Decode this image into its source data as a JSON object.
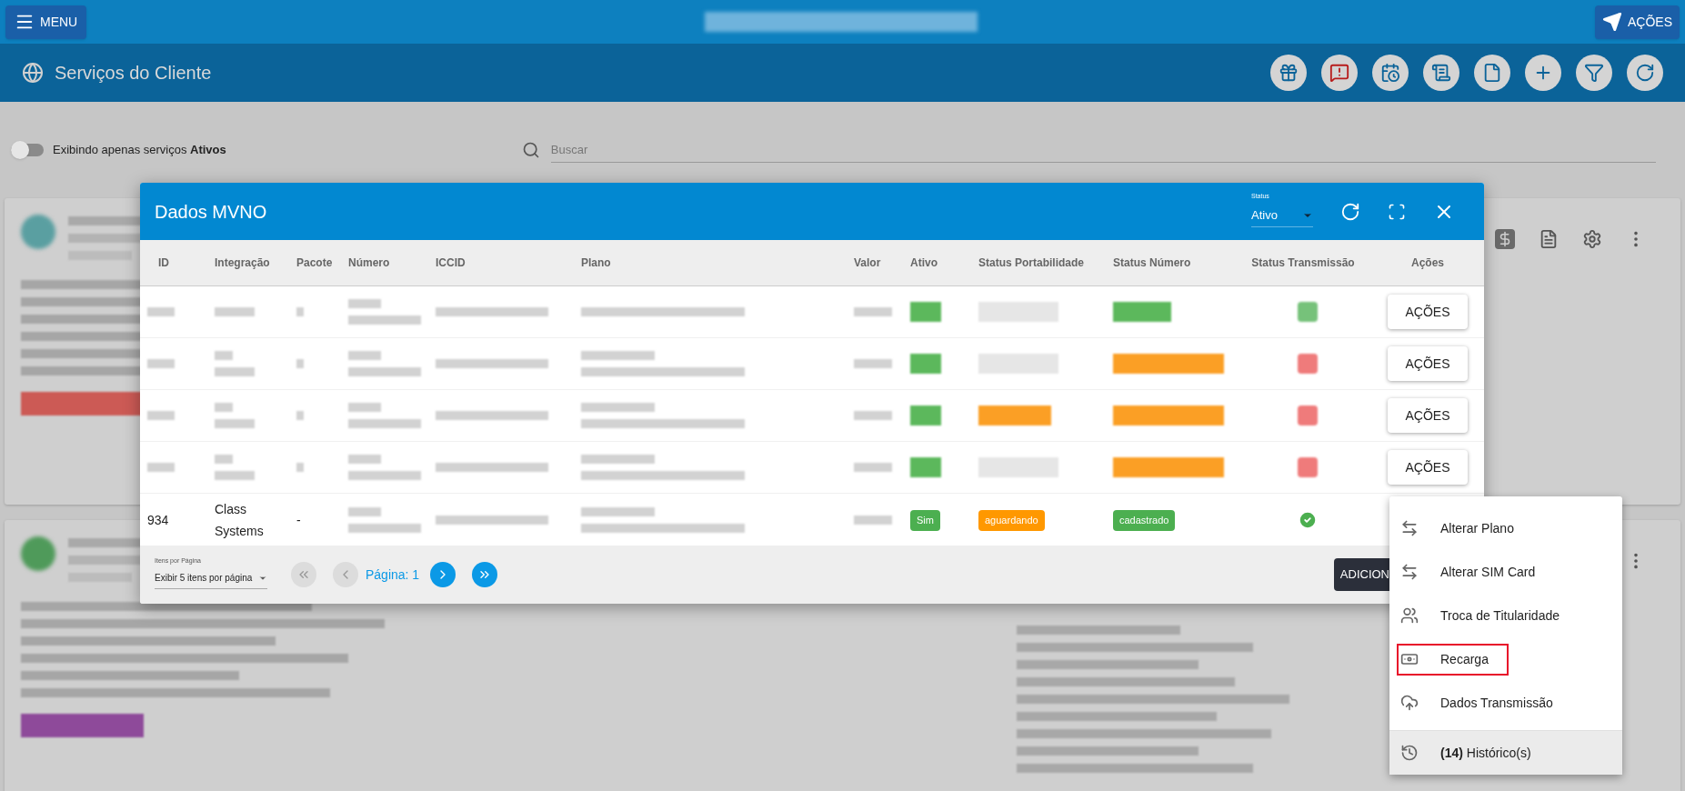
{
  "top_bar": {
    "menu_button": "MENU",
    "title_redacted": true,
    "actions_button": "AÇÕES"
  },
  "page_header": {
    "title": "Serviços do Cliente",
    "tools": [
      {
        "kind": "gift"
      },
      {
        "kind": "alert"
      },
      {
        "kind": "calendar"
      },
      {
        "kind": "list"
      },
      {
        "kind": "file"
      },
      {
        "kind": "add"
      },
      {
        "kind": "filter"
      },
      {
        "kind": "refresh"
      }
    ]
  },
  "filters": {
    "toggle": {
      "on": false,
      "label": "Exibindo apenas serviços **Ativos**"
    },
    "search": {
      "placeholder": "Buscar"
    }
  },
  "background_cards": [
    {
      "avatar": {
        "color": "#5a9fa1"
      },
      "tag": {
        "color": "#cc5a55"
      },
      "redacted": true,
      "side_redacted": false,
      "actions": [
        {
          "kind": "money"
        },
        {
          "kind": "notes"
        },
        {
          "kind": "settings"
        },
        {
          "kind": "more"
        }
      ]
    },
    {
      "avatar": {
        "color": "#4f9a5a"
      },
      "tag": {
        "color": "#8e4a9a"
      },
      "redacted": true,
      "side_redacted": true,
      "actions": [
        {
          "kind": "more"
        }
      ]
    }
  ],
  "dialog": {
    "title": "Dados MVNO",
    "status_filter": {
      "label": "Status",
      "value": "Ativo"
    },
    "columns": [
      "ID",
      "Integração",
      "Pacote",
      "Número",
      "ICCID",
      "Plano",
      "Valor",
      "Ativo",
      "Status Portabilidade",
      "Status Número",
      "Status Transmissão",
      "Ações"
    ],
    "rows": [
      {
        "cells": [
          {
            "kind": "blur"
          },
          {
            "kind": "blur"
          },
          {
            "kind": "blur-dot"
          },
          {
            "kind": "blur-two"
          },
          {
            "kind": "blur"
          },
          {
            "kind": "blur"
          },
          {
            "kind": "blur"
          },
          {
            "kind": "blur-badge",
            "color": "#5cb85c"
          },
          {
            "kind": "blur-badge",
            "color": "#e6e6e6"
          },
          {
            "kind": "blur-badge",
            "color": "#5cb85c"
          },
          {
            "kind": "blur-icon",
            "color": "#76c27a"
          },
          {
            "kind": "button",
            "label": "AÇÕES"
          }
        ]
      },
      {
        "cells": [
          {
            "kind": "blur"
          },
          {
            "kind": "blur-two"
          },
          {
            "kind": "blur-dot"
          },
          {
            "kind": "blur-two"
          },
          {
            "kind": "blur"
          },
          {
            "kind": "blur-two"
          },
          {
            "kind": "blur"
          },
          {
            "kind": "blur-badge",
            "color": "#5cb85c"
          },
          {
            "kind": "blur-badge",
            "color": "#e6e6e6"
          },
          {
            "kind": "blur-badge",
            "color": "#fb9f25"
          },
          {
            "kind": "blur-icon",
            "color": "#ef7b7b"
          },
          {
            "kind": "button",
            "label": "AÇÕES"
          }
        ]
      },
      {
        "cells": [
          {
            "kind": "blur"
          },
          {
            "kind": "blur-two"
          },
          {
            "kind": "blur-dot"
          },
          {
            "kind": "blur-two"
          },
          {
            "kind": "blur"
          },
          {
            "kind": "blur-two"
          },
          {
            "kind": "blur"
          },
          {
            "kind": "blur-badge",
            "color": "#5cb85c"
          },
          {
            "kind": "blur-badge",
            "color": "#fb9f25"
          },
          {
            "kind": "blur-badge",
            "color": "#fb9f25"
          },
          {
            "kind": "blur-icon",
            "color": "#ef7b7b"
          },
          {
            "kind": "button",
            "label": "AÇÕES"
          }
        ]
      },
      {
        "cells": [
          {
            "kind": "blur"
          },
          {
            "kind": "blur-two"
          },
          {
            "kind": "blur-dot"
          },
          {
            "kind": "blur-two"
          },
          {
            "kind": "blur"
          },
          {
            "kind": "blur-two"
          },
          {
            "kind": "blur"
          },
          {
            "kind": "blur-badge",
            "color": "#5cb85c"
          },
          {
            "kind": "blur-badge",
            "color": "#e6e6e6"
          },
          {
            "kind": "blur-badge",
            "color": "#fb9f25"
          },
          {
            "kind": "blur-icon",
            "color": "#ef7b7b"
          },
          {
            "kind": "button",
            "label": "AÇÕES"
          }
        ]
      },
      {
        "cells": [
          {
            "kind": "text",
            "text": "934"
          },
          {
            "kind": "text",
            "text": "Class Systems"
          },
          {
            "kind": "text",
            "text": "-"
          },
          {
            "kind": "blur-two"
          },
          {
            "kind": "blur"
          },
          {
            "kind": "blur-two"
          },
          {
            "kind": "blur"
          },
          {
            "kind": "badge",
            "text": "Sim",
            "color": "#4caf50"
          },
          {
            "kind": "badge",
            "text": "aguardando",
            "color": "#ff9800"
          },
          {
            "kind": "badge",
            "text": "cadastrado",
            "color": "#4caf50"
          },
          {
            "kind": "check"
          },
          {
            "kind": "empty"
          }
        ]
      }
    ],
    "pagination": {
      "per_page_label": "Itens por Página",
      "per_page_value": "Exibir 5 itens por página",
      "page": "Página: 1",
      "first_enabled": false,
      "prev_enabled": false,
      "next_enabled": true,
      "last_enabled": true
    },
    "add_button": "ADICION"
  },
  "menu": {
    "items": [
      {
        "kind": "swap",
        "label": "Alterar Plano",
        "outlined": false,
        "focused": false
      },
      {
        "kind": "swap",
        "label": "Alterar SIM Card",
        "outlined": false,
        "focused": false
      },
      {
        "kind": "people",
        "label": "Troca de Titularidade",
        "outlined": false,
        "focused": false
      },
      {
        "kind": "money",
        "label": "Recarga",
        "outlined": true,
        "focused": false
      },
      {
        "kind": "upload",
        "label": "Dados Transmissão",
        "outlined": false,
        "focused": false
      },
      {
        "kind": "history",
        "label": "**(14)** Histórico(s)",
        "outlined": false,
        "focused": true
      }
    ]
  }
}
